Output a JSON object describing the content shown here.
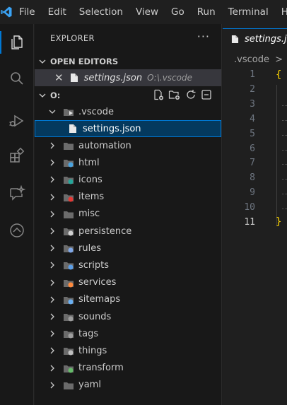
{
  "menu": {
    "items": [
      "File",
      "Edit",
      "Selection",
      "View",
      "Go",
      "Run",
      "Terminal",
      "H"
    ]
  },
  "colors": {
    "accent": "#0078d4",
    "selected_bg": "#04395e",
    "brace": "#ffd700"
  },
  "sidebar": {
    "title": "EXPLORER",
    "more": "···",
    "open_editors": {
      "label": "OPEN EDITORS",
      "items": [
        {
          "name": "settings.json",
          "path": "O:\\.vscode"
        }
      ]
    },
    "root": {
      "label": "O:",
      "vscode_folder": ".vscode",
      "vscode_file": "settings.json",
      "folders": [
        {
          "name": "automation",
          "icon": "folder-icon"
        },
        {
          "name": "html",
          "icon": "folder-html-icon"
        },
        {
          "name": "icons",
          "icon": "folder-images-icon"
        },
        {
          "name": "items",
          "icon": "folder-items-icon"
        },
        {
          "name": "misc",
          "icon": "folder-icon"
        },
        {
          "name": "persistence",
          "icon": "folder-database-icon"
        },
        {
          "name": "rules",
          "icon": "folder-rules-icon"
        },
        {
          "name": "scripts",
          "icon": "folder-scripts-icon"
        },
        {
          "name": "services",
          "icon": "folder-services-icon"
        },
        {
          "name": "sitemaps",
          "icon": "folder-sitemap-icon"
        },
        {
          "name": "sounds",
          "icon": "folder-sounds-icon"
        },
        {
          "name": "tags",
          "icon": "folder-tags-icon"
        },
        {
          "name": "things",
          "icon": "folder-things-icon"
        },
        {
          "name": "transform",
          "icon": "folder-transform-icon"
        },
        {
          "name": "yaml",
          "icon": "folder-icon"
        }
      ]
    }
  },
  "editor": {
    "tab_label": "settings.json",
    "breadcrumb_folder": ".vscode",
    "breadcrumb_sep": ">",
    "line_numbers": [
      "1",
      "2",
      "3",
      "4",
      "5",
      "6",
      "7",
      "8",
      "9",
      "10",
      "11"
    ],
    "current_line": "11",
    "open_brace": "{",
    "close_brace": "}"
  }
}
